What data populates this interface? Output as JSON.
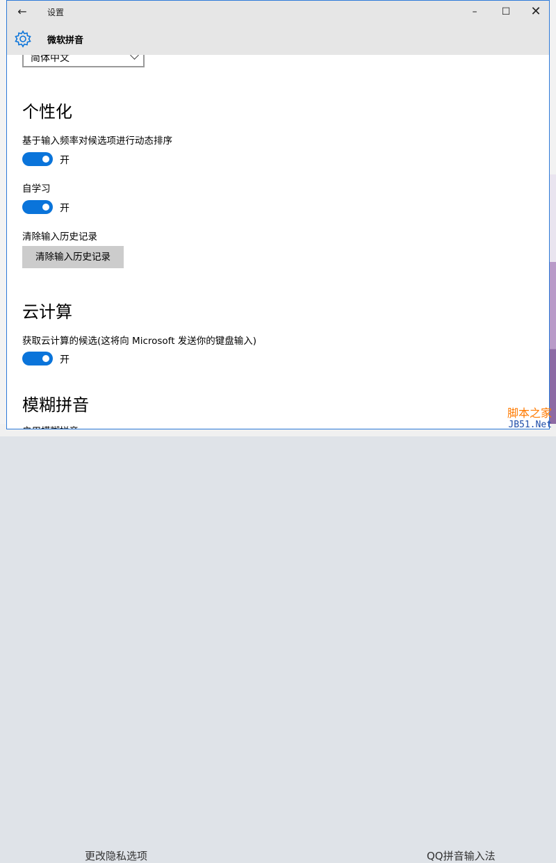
{
  "window": {
    "title": "设置",
    "page_title": "微软拼音",
    "controls": {
      "minimize": "–",
      "maximize": "☐",
      "close": "✕"
    },
    "back_icon": "←"
  },
  "language_select": {
    "value": "简体中文"
  },
  "sections": {
    "personalization": {
      "title": "个性化",
      "dynamic_sort": {
        "label": "基于输入频率对候选项进行动态排序",
        "state": "开"
      },
      "self_learning": {
        "label": "自学习",
        "state": "开"
      },
      "clear_history": {
        "label": "清除输入历史记录",
        "button": "清除输入历史记录"
      }
    },
    "cloud": {
      "title": "云计算",
      "cloud_candidates": {
        "label": "获取云计算的候选(这将向 Microsoft 发送你的键盘输入)",
        "state": "开"
      }
    },
    "fuzzy": {
      "title": "模糊拼音",
      "enable_label": "启用模糊拼音"
    }
  },
  "background": {
    "bottom_left_text": "更改隐私选项",
    "bottom_right_text": "QQ拼音输入法"
  },
  "watermark": {
    "line1": "脚本之家",
    "line2": "JB51.Net"
  },
  "colors": {
    "accent": "#0a74da",
    "titlebar": "#e6e6e6",
    "window_border": "#2b79d9"
  }
}
